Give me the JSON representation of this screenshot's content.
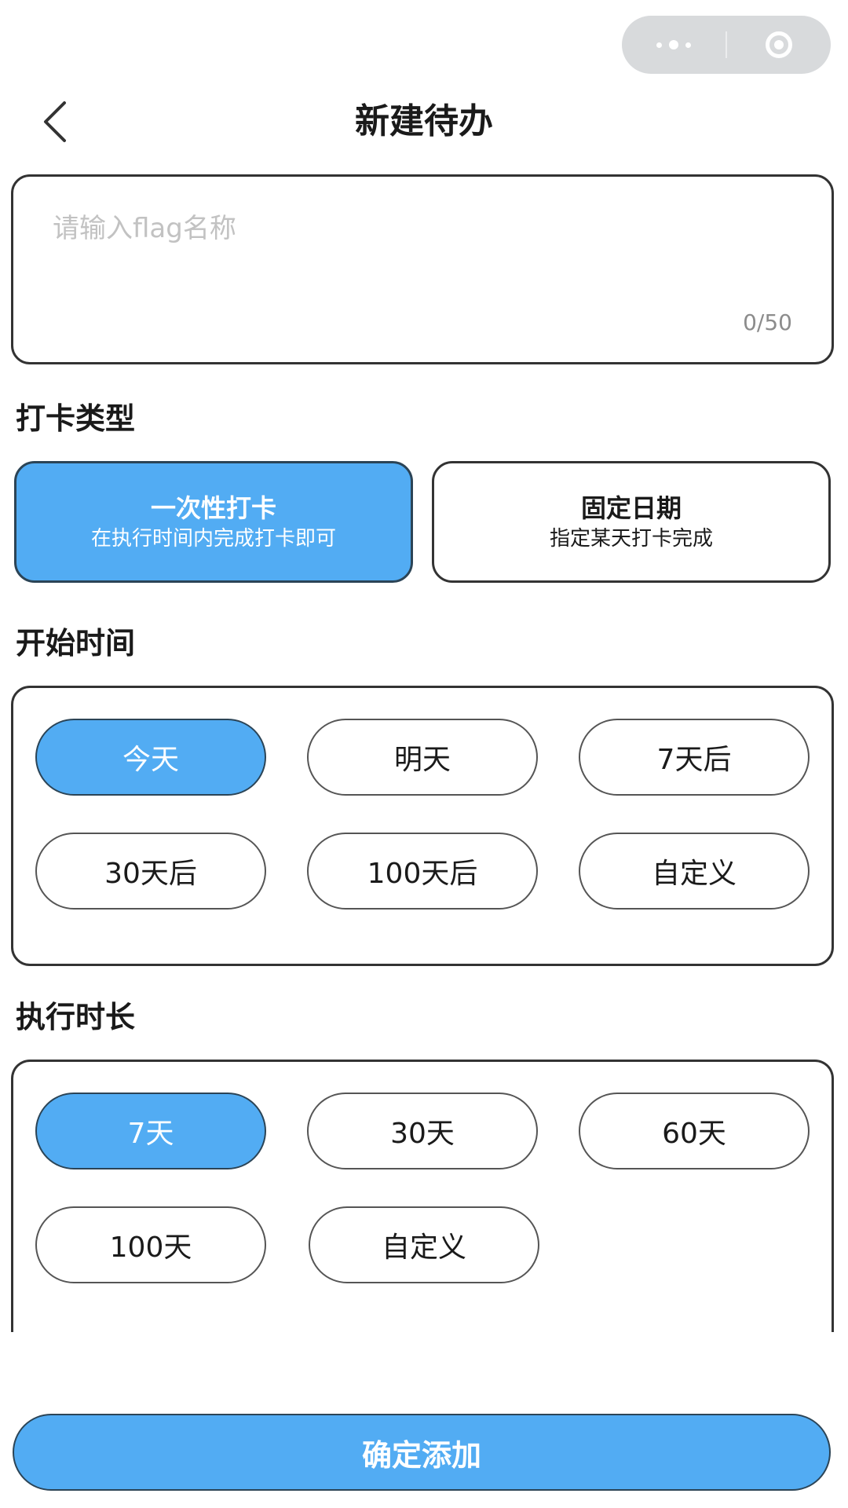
{
  "header": {
    "title": "新建待办"
  },
  "name_field": {
    "placeholder": "请输入flag名称",
    "value": "",
    "counter": "0/50"
  },
  "checkin_type": {
    "label": "打卡类型",
    "options": [
      {
        "title": "一次性打卡",
        "desc": "在执行时间内完成打卡即可",
        "selected": true
      },
      {
        "title": "固定日期",
        "desc": "指定某天打卡完成",
        "selected": false
      }
    ]
  },
  "start_time": {
    "label": "开始时间",
    "options": [
      {
        "label": "今天",
        "selected": true
      },
      {
        "label": "明天",
        "selected": false
      },
      {
        "label": "7天后",
        "selected": false
      },
      {
        "label": "30天后",
        "selected": false
      },
      {
        "label": "100天后",
        "selected": false
      },
      {
        "label": "自定义",
        "selected": false
      }
    ]
  },
  "duration": {
    "label": "执行时长",
    "options": [
      {
        "label": "7天",
        "selected": true
      },
      {
        "label": "30天",
        "selected": false
      },
      {
        "label": "60天",
        "selected": false
      },
      {
        "label": "100天",
        "selected": false
      },
      {
        "label": "自定义",
        "selected": false
      }
    ]
  },
  "confirm_button": {
    "label": "确定添加"
  },
  "colors": {
    "accent": "#52acf3",
    "border": "#333333",
    "capsule": "#d8dadc"
  },
  "icons": {
    "back": "chevron-left-icon",
    "more": "more-dots-icon",
    "close": "target-close-icon"
  }
}
